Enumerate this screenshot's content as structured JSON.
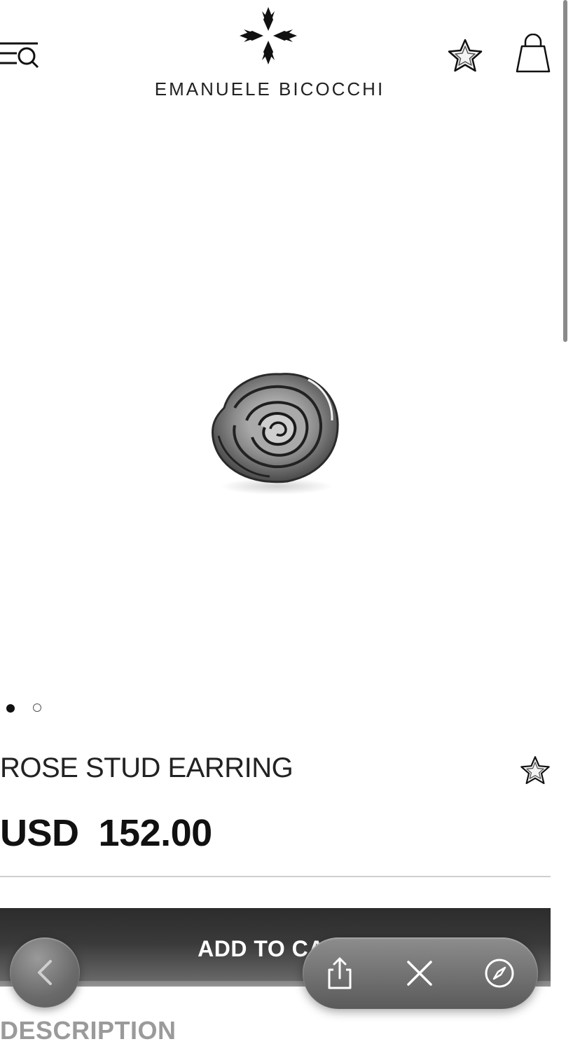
{
  "header": {
    "brand_name": "EMANUELE BICOCCHI",
    "menu_icon": "menu-search-icon",
    "wishlist_icon": "star-icon",
    "cart_icon": "shopping-bag-icon"
  },
  "gallery": {
    "image_alt": "rose-stud-earring-photo",
    "slide_count": 2,
    "active_slide": 1
  },
  "product": {
    "title": "ROSE STUD EARRING",
    "currency": "USD",
    "price": "152.00"
  },
  "actions": {
    "add_to_cart_label": "ADD TO CA"
  },
  "sections": {
    "description_label": "DESCRIPTION"
  },
  "browser_controls": {
    "back_icon": "chevron-left-icon",
    "share_icon": "share-icon",
    "close_icon": "close-icon",
    "compass_icon": "compass-icon"
  },
  "colors": {
    "text": "#1a1a1a",
    "button": "#2c2c2c",
    "divider": "#cfcfcf"
  }
}
